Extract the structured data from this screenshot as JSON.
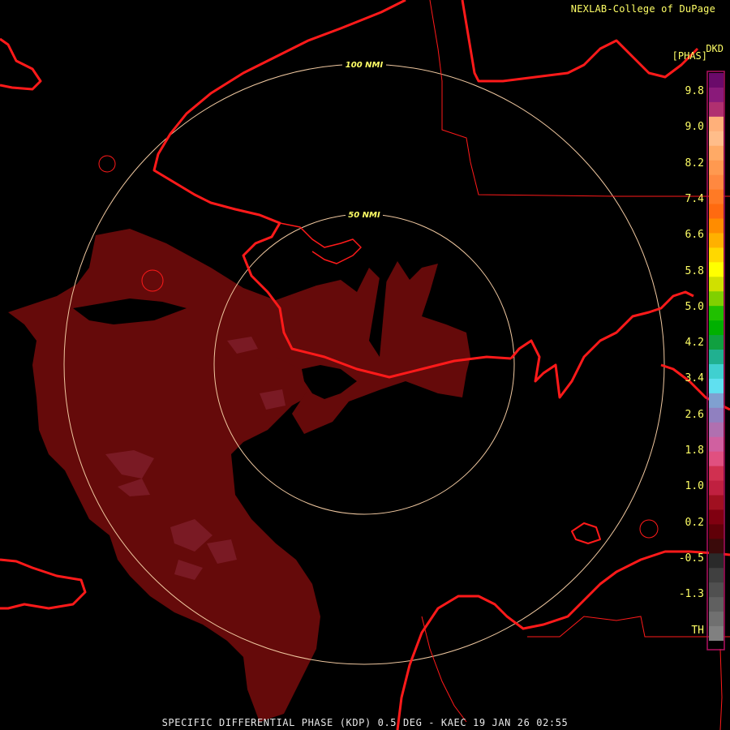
{
  "header": {
    "credit": "NEXLAB-College of DuPage"
  },
  "legend": {
    "product": "DKD",
    "unit": "[PHAS]",
    "ticks": [
      "9.8",
      "9.0",
      "8.2",
      "7.4",
      "6.6",
      "5.8",
      "5.0",
      "4.2",
      "3.4",
      "2.6",
      "1.8",
      "1.0",
      "0.2",
      "-0.5",
      "-1.3",
      "TH"
    ],
    "colors": [
      "#6a0a6a",
      "#8a1a7a",
      "#b03070",
      "#ffb07a",
      "#ffbd8a",
      "#ffaa66",
      "#ff9950",
      "#ff8840",
      "#ff7a25",
      "#ff6a10",
      "#ff8c00",
      "#ffb000",
      "#ffd800",
      "#ffff00",
      "#d0e000",
      "#80d000",
      "#20c000",
      "#00b000",
      "#10a040",
      "#20b090",
      "#40d0d0",
      "#60e0f0",
      "#80a0d0",
      "#9080c0",
      "#b070b0",
      "#d060a0",
      "#e05080",
      "#d03050",
      "#c02040",
      "#a01020",
      "#800010",
      "#600008",
      "#3a0a0a",
      "#2a2a2a",
      "#404040",
      "#505050",
      "#606060",
      "#707070",
      "#808080"
    ]
  },
  "rings": {
    "inner_label": "50 NMI",
    "outer_label": "100 NMI",
    "color": "#f0c8a0"
  },
  "map": {
    "coastline_color": "#ff1a1a",
    "echo_color": "#650a0a",
    "echo_highlight": "#7a1a24"
  },
  "footer": {
    "text": "SPECIFIC DIFFERENTIAL PHASE (KDP) 0.5 DEG - KAEC 19 JAN 26 02:55"
  }
}
